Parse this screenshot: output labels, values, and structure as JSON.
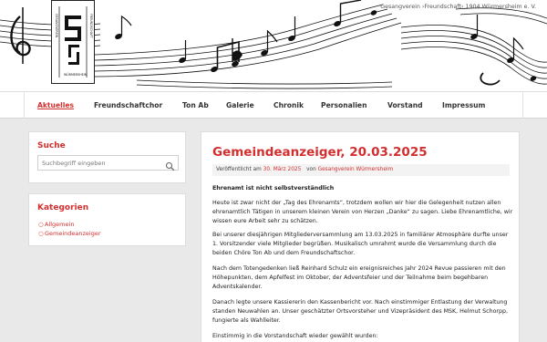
{
  "header": {
    "site_title": "Gesangverein ›Freundschaft‹ 1904 Würmersheim e. V.",
    "logo_text": "GESANGVEREIN ›FREUNDSCHAFT‹ WÜRMERSHEIM"
  },
  "nav": {
    "items": [
      {
        "label": "Aktuelles",
        "active": true
      },
      {
        "label": "Freundschaftchor",
        "active": false
      },
      {
        "label": "Ton Ab",
        "active": false
      },
      {
        "label": "Galerie",
        "active": false
      },
      {
        "label": "Chronik",
        "active": false
      },
      {
        "label": "Personalien",
        "active": false
      },
      {
        "label": "Vorstand",
        "active": false
      },
      {
        "label": "Impressum",
        "active": false
      }
    ]
  },
  "sidebar": {
    "search": {
      "title": "Suche",
      "placeholder": "Suchbegriff eingeben",
      "icon": "search-icon"
    },
    "categories": {
      "title": "Kategorien",
      "items": [
        "Allgemein",
        "Gemeindeanzeiger"
      ]
    }
  },
  "post": {
    "title": "Gemeindeanzeiger, 20.03.2025",
    "meta": {
      "published_label": "Veröffentlicht am",
      "date": "30. März 2025",
      "by_label": "von",
      "author": "Gesangverein Würmersheim"
    },
    "heading": "Ehrenamt ist nicht selbstverständlich",
    "paragraphs": [
      "Heute ist zwar nicht der „Tag des Ehrenamts“, trotzdem wollen wir hier die Gelegenheit nutzen allen ehrenamtlich Tätigen in unserem kleinen Verein von Herzen „Danke“ zu sagen. Liebe Ehrenamtliche, wir wissen eure Arbeit sehr zu schätzen.",
      "Bei unserer diesjährigen Mitgliederversammlung am 13.03.2025 in familiärer Atmosphäre durfte unser 1. Vorsitzender viele Mitglieder begrüßen. Musikalisch umrahmt wurde die Versammlung durch die beiden Chöre Ton Ab und dem Freundschaftschor.",
      "Nach dem Totengedenken ließ Reinhard Schulz ein ereignisreiches Jahr 2024 Revue passieren mit den Höhepunkten, dem Apfelfest im Oktober, der Adventsfeier und der Teilnahme beim begehbaren Adventskalender.",
      "Danach legte unsere Kassiererin den Kassenbericht vor. Nach einstimmiger Entlastung der Verwaltung standen Neuwahlen an. Unser geschätzter Ortsvorsteher und Vizepräsident des MSK, Helmut Schorpp, fungierte als Wahlleiter.",
      "Einstimmig in die Vorstandschaft wieder gewählt wurden:"
    ]
  },
  "colors": {
    "accent": "#d32f2f",
    "background": "#e9e9e9",
    "panel": "#ffffff",
    "meta_bg": "#f3f3f3"
  }
}
